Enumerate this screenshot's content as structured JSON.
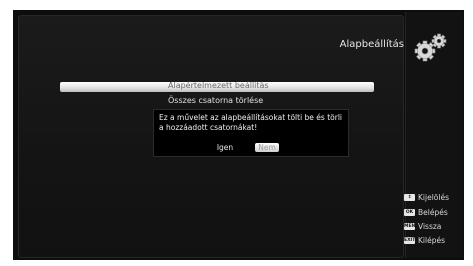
{
  "header": {
    "title": "Alapbeállítás",
    "icon": "gears-icon"
  },
  "menu": {
    "items": [
      {
        "label": "Alapértelmezett beállítás",
        "selected": true
      },
      {
        "label": "Összes csatorna törlése",
        "selected": false
      }
    ]
  },
  "dialog": {
    "message": "Ez a művelet az alapbeállításokat tölti be és törli a hozzáadott csatornákat!",
    "yes_label": "Igen",
    "no_label": "Nem",
    "selected": "no"
  },
  "legend": [
    {
      "key": "⇕",
      "label": "Kijelölés",
      "icon": "updown-key-icon"
    },
    {
      "key": "OK",
      "label": "Belépés",
      "icon": "ok-key-icon"
    },
    {
      "key": "MENU",
      "label": "Vissza",
      "icon": "menu-key-icon"
    },
    {
      "key": "EXIT",
      "label": "Kilépés",
      "icon": "exit-key-icon"
    }
  ]
}
